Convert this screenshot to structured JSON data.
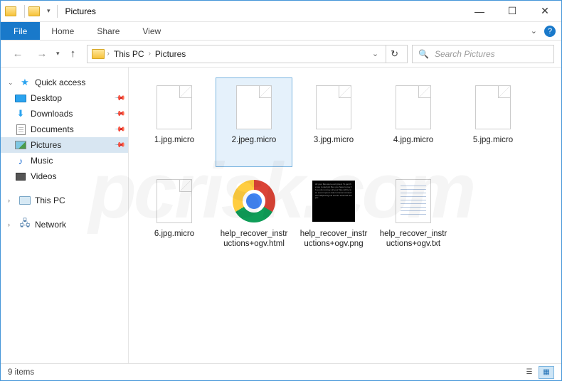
{
  "titlebar": {
    "title": "Pictures"
  },
  "ribbon": {
    "file": "File",
    "tabs": [
      "Home",
      "Share",
      "View"
    ]
  },
  "address": {
    "crumbs": [
      "This PC",
      "Pictures"
    ]
  },
  "search": {
    "placeholder": "Search Pictures"
  },
  "sidebar": {
    "quick_access": "Quick access",
    "quick_items": [
      {
        "label": "Desktop",
        "icon": "desktop",
        "pinned": true
      },
      {
        "label": "Downloads",
        "icon": "downloads",
        "pinned": true
      },
      {
        "label": "Documents",
        "icon": "documents",
        "pinned": true
      },
      {
        "label": "Pictures",
        "icon": "pictures",
        "pinned": true,
        "selected": true
      },
      {
        "label": "Music",
        "icon": "music",
        "pinned": false
      },
      {
        "label": "Videos",
        "icon": "videos",
        "pinned": false
      }
    ],
    "this_pc": "This PC",
    "network": "Network"
  },
  "files": [
    {
      "name": "1.jpg.micro",
      "type": "blank"
    },
    {
      "name": "2.jpeg.micro",
      "type": "blank",
      "selected": true
    },
    {
      "name": "3.jpg.micro",
      "type": "blank"
    },
    {
      "name": "4.jpg.micro",
      "type": "blank"
    },
    {
      "name": "5.jpg.micro",
      "type": "blank"
    },
    {
      "name": "6.jpg.micro",
      "type": "blank"
    },
    {
      "name": "help_recover_instructions+ogv.html",
      "type": "chrome"
    },
    {
      "name": "help_recover_instructions+ogv.png",
      "type": "png"
    },
    {
      "name": "help_recover_instructions+ogv.txt",
      "type": "txt"
    }
  ],
  "statusbar": {
    "count": "9 items"
  },
  "watermark": "pcrisk.com"
}
